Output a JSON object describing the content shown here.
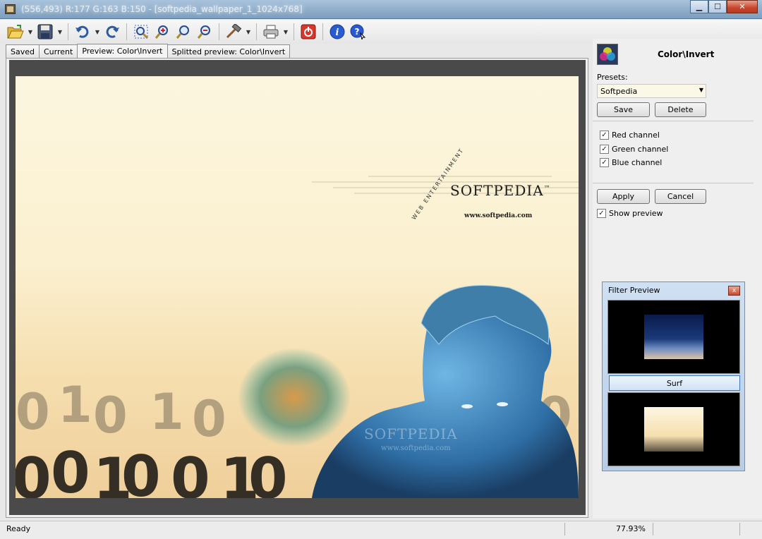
{
  "window": {
    "title": "(556,493)  R:177  G:163  B:150 - [softpedia_wallpaper_1_1024x768]",
    "minimize": "▁",
    "maximize": "☐",
    "close": "✕"
  },
  "toolbar": {
    "icons": [
      "open-icon",
      "save-icon",
      "undo-icon",
      "redo-icon",
      "zoom-fit-icon",
      "zoom-in-icon",
      "zoom-actual-icon",
      "zoom-out-icon",
      "tools-icon",
      "print-icon",
      "exit-icon",
      "info-icon",
      "help-icon"
    ]
  },
  "tabs": [
    {
      "label": "Saved"
    },
    {
      "label": "Current"
    },
    {
      "label": "Preview: Color\\Invert"
    },
    {
      "label": "Splitted preview: Color\\Invert"
    }
  ],
  "image": {
    "brand": "SOFTPEDIA",
    "tm": "™",
    "url": "www.softpedia.com",
    "tagline": "WEB ENTERTAINMENT",
    "watermark": "SOFTPEDIA",
    "watermark_url": "www.softpedia.com"
  },
  "panel": {
    "filter_title": "Color\\Invert",
    "presets_label": "Presets:",
    "preset_value": "Softpedia",
    "save_label": "Save",
    "delete_label": "Delete",
    "channels": [
      {
        "label": "Red channel",
        "checked": "✓"
      },
      {
        "label": "Green channel",
        "checked": "✓"
      },
      {
        "label": "Blue channel",
        "checked": "✓"
      }
    ],
    "apply_label": "Apply",
    "cancel_label": "Cancel",
    "show_preview_label": "Show preview",
    "show_preview_checked": "✓"
  },
  "filter_preview": {
    "title": "Filter Preview",
    "close": "x",
    "button_label": "Surf"
  },
  "status": {
    "text": "Ready",
    "zoom": "77.93%"
  }
}
